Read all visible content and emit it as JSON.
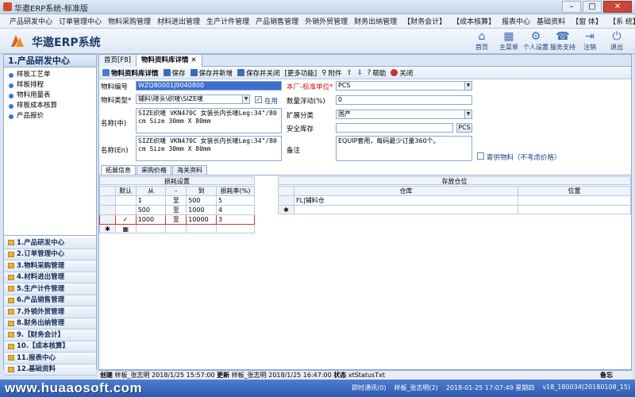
{
  "window": {
    "title": "华邀ERP系统-标准版",
    "min": "–",
    "max": "□",
    "close": "✕"
  },
  "menu": [
    "产品研发中心",
    "订单管理中心",
    "物料采购管理",
    "材料进出管理",
    "生产计件管理",
    "产品销售管理",
    "外销外贸管理",
    "财务出纳管理",
    "【财务会计】",
    "【成本核算】",
    "报表中心",
    "基础资料",
    "【窗 体】",
    "【系 统】"
  ],
  "brand": "华遨ERP系统",
  "header_tools": [
    {
      "label": "首页",
      "icon": "home-icon",
      "glyph": "⌂"
    },
    {
      "label": "主菜单",
      "icon": "grid-icon",
      "glyph": "▦"
    },
    {
      "label": "个人设置",
      "icon": "gear-icon",
      "glyph": "⚙"
    },
    {
      "label": "服务支持",
      "icon": "support-icon",
      "glyph": "☎"
    },
    {
      "label": "注销",
      "icon": "logout-icon",
      "glyph": "⇥"
    },
    {
      "label": "退出",
      "icon": "power-icon",
      "glyph": "⏻"
    }
  ],
  "sidebar": {
    "title": "1.产品研发中心",
    "items": [
      "样板工艺单",
      "样板排程",
      "物料用量表",
      "样板成本核算",
      "产品报价"
    ],
    "groups": [
      "1.产品研发中心",
      "2.订单管理中心",
      "3.物料采购管理",
      "4.材料进出管理",
      "5.生产计件管理",
      "6.产品销售管理",
      "7.外销外贸管理",
      "8.财务出纳管理",
      "9.【财务会计】",
      "10.【成本核算】",
      "11.报表中心",
      "12.基础资料"
    ]
  },
  "tabs": {
    "home": "首页[F8]",
    "active": "物料资料库详情",
    "close": "✕"
  },
  "toolbar": {
    "title": "物料资料库详情",
    "save": "保存",
    "save_new": "保存并新增",
    "save_close": "保存并关闭",
    "more": "[更多功能]",
    "attach": "附件",
    "help": "帮助",
    "close": "关闭"
  },
  "form": {
    "code_label": "物料编号",
    "code_value": "WZQ80001J9040800",
    "type_label": "物料类型*",
    "type_value": "辅料\\嘜头\\织唛\\SIZE唛",
    "enabled_label": "在用",
    "enabled": "✓",
    "name_cn_label": "名称(中)",
    "name_cn_value": "SIZE织唛 VKN470C 女装长内长唛Leg:34\"/80cm Size 30mm X 80mm",
    "name_en_label": "名称(En)",
    "name_en_value": "SIZE织唛 VKN470C 女装长内长唛Leg:34\"/80cm Size 30mm X 80mm",
    "unit_label": "本厂-标准单位*",
    "unit_value": "PCS",
    "float_label": "数量浮动(%)",
    "float_value": "0",
    "category_label": "扩展分类",
    "category_value": "国产",
    "stock_label": "安全库存",
    "stock_value": "",
    "stock_unit": "PCS",
    "remark_label": "备注",
    "remark_value": "EQUIP套用，每码最少订量360个。",
    "supply_label": "寄供物料（不考虑价格）"
  },
  "subtabs": [
    "拓展信息",
    "采购价格",
    "海关资料"
  ],
  "loss": {
    "title": "损耗设置",
    "headers": [
      "默认",
      "从",
      "-",
      "到",
      "损耗率(%)"
    ],
    "rows": [
      {
        "default": "",
        "from": "1",
        "sep": "至",
        "to": "500",
        "rate": "5"
      },
      {
        "default": "",
        "from": "500",
        "sep": "至",
        "to": "1000",
        "rate": "4"
      },
      {
        "default": "✓",
        "from": "1000",
        "sep": "至",
        "to": "10000",
        "rate": "3"
      }
    ],
    "new_marker": "✱"
  },
  "storage": {
    "title": "存放仓位",
    "headers": [
      "仓库",
      "位置"
    ],
    "rows": [
      {
        "warehouse": "FL|辅料仓",
        "location": ""
      }
    ],
    "new_marker": "✱"
  },
  "status": {
    "created_label": "创建",
    "created_by": "样板_张志明",
    "created_at": "2018/1/25 15:57:00",
    "updated_label": "更新",
    "updated_by": "样板_张志明",
    "updated_at": "2018/1/25 16:47:00",
    "state_label": "状态",
    "state_value": "xtStatusTxt",
    "notes": "备忘"
  },
  "bottom": {
    "watermark": "www.huaaosoft.com",
    "im": "即时通讯(0)",
    "user": "样板_张志明(2)",
    "datetime": "2018-01-25 17:07:49 星期四",
    "version": "v18_180034(20180108_15)"
  },
  "colors": {
    "accent": "#3d6fd0",
    "required": "#cc1111",
    "bar": "#2d5aae"
  }
}
